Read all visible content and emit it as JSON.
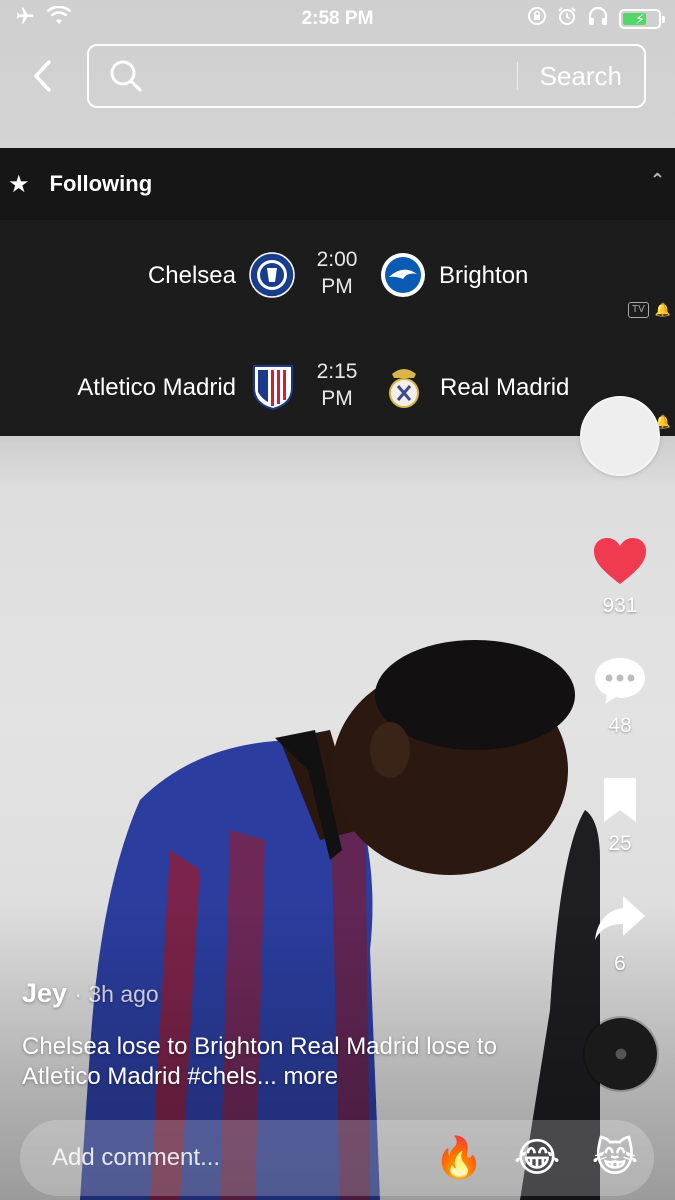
{
  "status_bar": {
    "time": "2:58 PM",
    "icons": [
      "airplane-mode-icon",
      "wifi-icon",
      "rotation-lock-icon",
      "alarm-icon",
      "headphones-icon",
      "battery-charging-icon"
    ],
    "battery_color": "#53d769"
  },
  "top_nav": {
    "back_icon": "chevron-left-icon",
    "search_placeholder": "",
    "search_button": "Search"
  },
  "scores": {
    "header": "Following",
    "matches": [
      {
        "home": "Chelsea",
        "home_crest": "chelsea-crest",
        "kickoff_line1": "2:00",
        "kickoff_line2": "PM",
        "away": "Brighton",
        "away_crest": "brighton-crest"
      },
      {
        "home": "Atletico Madrid",
        "home_crest": "atletico-madrid-crest",
        "kickoff_line1": "2:15",
        "kickoff_line2": "PM",
        "away": "Real Madrid",
        "away_crest": "real-madrid-crest"
      }
    ]
  },
  "actions": {
    "likes": "931",
    "comments": "48",
    "saves": "25",
    "shares": "6",
    "like_color": "#ef3a4f"
  },
  "post": {
    "author": "Jey",
    "time_ago": "· 3h ago",
    "caption": "Chelsea lose to Brighton  Real Madrid lose to Atletico Madrid #chels...",
    "more": "more"
  },
  "comment_bar": {
    "placeholder": "Add comment...",
    "emojis": [
      "🔥",
      "😂",
      "😹"
    ]
  }
}
